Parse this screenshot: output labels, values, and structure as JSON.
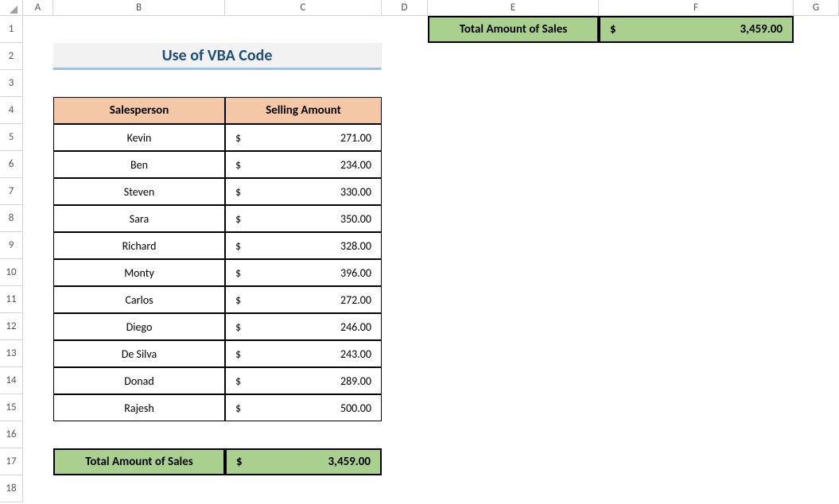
{
  "columns": [
    "A",
    "B",
    "C",
    "D",
    "E",
    "F",
    "G"
  ],
  "rows": [
    "1",
    "2",
    "3",
    "4",
    "5",
    "6",
    "7",
    "8",
    "9",
    "10",
    "11",
    "12",
    "13",
    "14",
    "15",
    "16",
    "17",
    "18"
  ],
  "title": "Use of VBA Code",
  "headers": {
    "salesperson": "Salesperson",
    "amount": "Selling Amount"
  },
  "currency_symbol": "$",
  "salespeople": [
    {
      "name": "Kevin",
      "amount": "271.00"
    },
    {
      "name": "Ben",
      "amount": "234.00"
    },
    {
      "name": "Steven",
      "amount": "330.00"
    },
    {
      "name": "Sara",
      "amount": "350.00"
    },
    {
      "name": "Richard",
      "amount": "328.00"
    },
    {
      "name": "Monty",
      "amount": "396.00"
    },
    {
      "name": "Carlos",
      "amount": "272.00"
    },
    {
      "name": "Diego",
      "amount": "246.00"
    },
    {
      "name": "De Silva",
      "amount": "243.00"
    },
    {
      "name": "Donad",
      "amount": "289.00"
    },
    {
      "name": "Rajesh",
      "amount": "500.00"
    }
  ],
  "total_label": "Total Amount of Sales",
  "total_value": "3,459.00"
}
